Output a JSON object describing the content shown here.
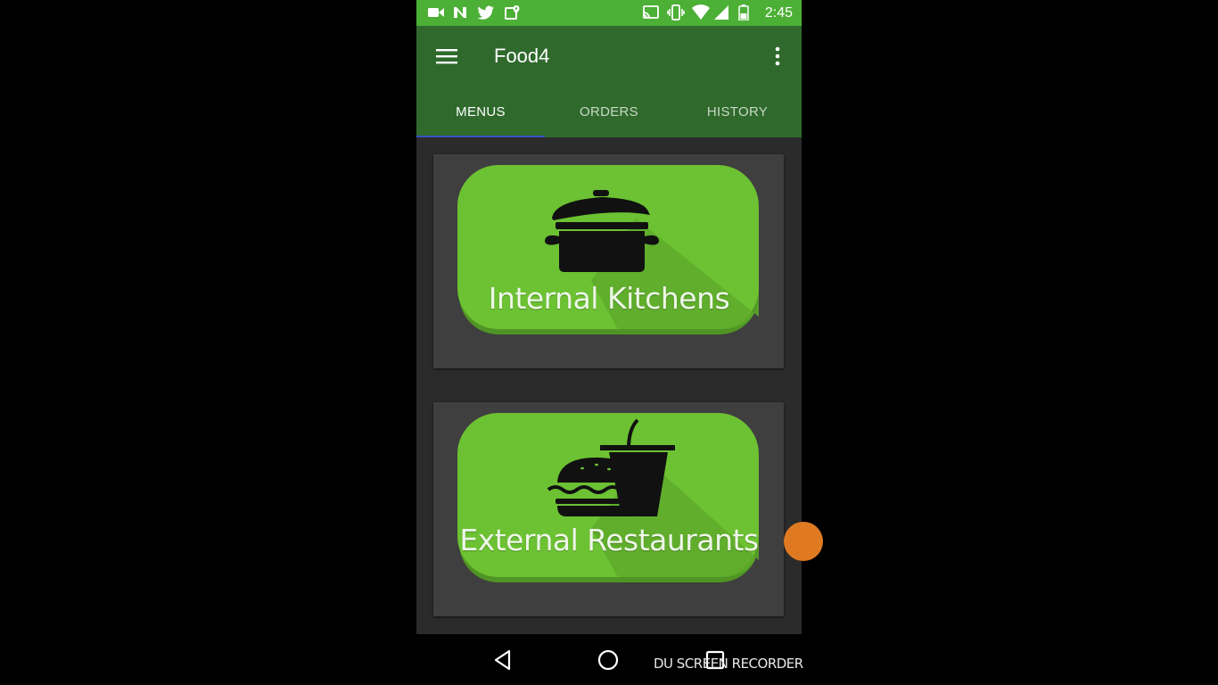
{
  "status_bar": {
    "time": "2:45",
    "left_icons": [
      "video-camera-icon",
      "n-notification-icon",
      "twitter-icon",
      "maps-icon"
    ],
    "right_icons": [
      "cast-icon",
      "vibrate-icon",
      "wifi-icon",
      "cell-signal-icon",
      "battery-icon"
    ]
  },
  "toolbar": {
    "title": "Food4",
    "menu_icon": "hamburger-menu-icon",
    "overflow_icon": "more-vert-icon"
  },
  "tabs": [
    {
      "label": "MENUS",
      "active": true
    },
    {
      "label": "ORDERS",
      "active": false
    },
    {
      "label": "HISTORY",
      "active": false
    }
  ],
  "cards": [
    {
      "label": "Internal Kitchens",
      "icon": "cooking-pot-icon"
    },
    {
      "label": "External Restaurants",
      "icon": "burger-and-drink-icon"
    }
  ],
  "nav_bar": {
    "back_icon": "back-triangle-icon",
    "home_icon": "home-circle-icon",
    "recents_icon": "recents-square-icon"
  },
  "watermark": "DU SCREEN RECORDER",
  "colors": {
    "status_bar": "#4caf36",
    "toolbar": "#2f6a2c",
    "tab_indicator": "#3a52c8",
    "content_bg": "#2b2b2b",
    "card_bg": "#3f3f3f",
    "badge_green": "#6cc232",
    "fab": "#e07a22"
  }
}
